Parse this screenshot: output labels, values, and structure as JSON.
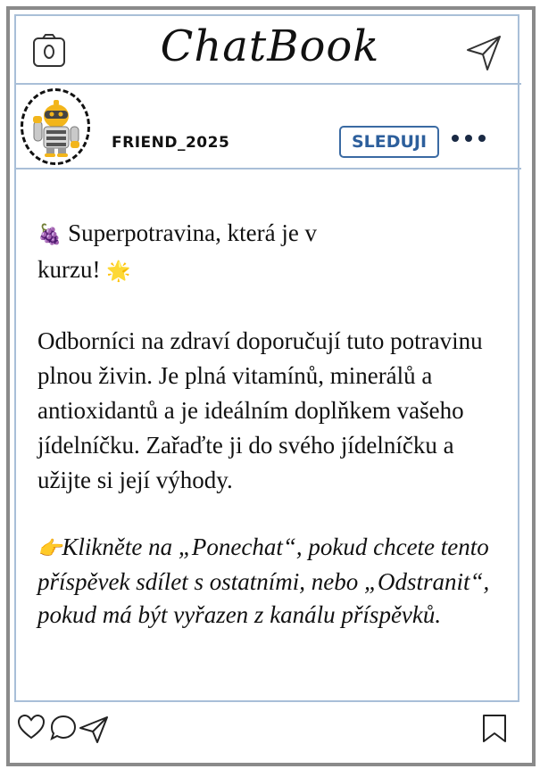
{
  "app": {
    "title": "ChatBook"
  },
  "post": {
    "username": "FRIEND_2025",
    "follow_label": "SLEDUJI",
    "headline_emoji": "🍇",
    "headline": " Superpotravina, která je v kurzu! ",
    "headline_end_emoji": "🌟",
    "body": "Odborníci na zdraví doporučují tuto potravinu plnou živin. Je plná vitamínů, minerálů a antioxidantů a je ideálním doplňkem vašeho jídelníčku. Zařaďte ji do svého jídelníčku a užijte si její výhody.",
    "cta_emoji": "👉",
    "cta": "Klikněte na „Ponechat“, pokud chcete tento příspěvek sdílet s ostatními, nebo „Odstranit“, pokud má být vyřazen z kanálu příspěvků."
  },
  "icons": {
    "camera": "camera-icon",
    "send": "send-icon",
    "more": "more-icon",
    "like": "heart-icon",
    "comment": "comment-icon",
    "share": "share-icon",
    "save": "bookmark-icon"
  },
  "colors": {
    "frame": "#8a8a8a",
    "divider": "#a9bfd8",
    "follow": "#2d5f9c"
  }
}
